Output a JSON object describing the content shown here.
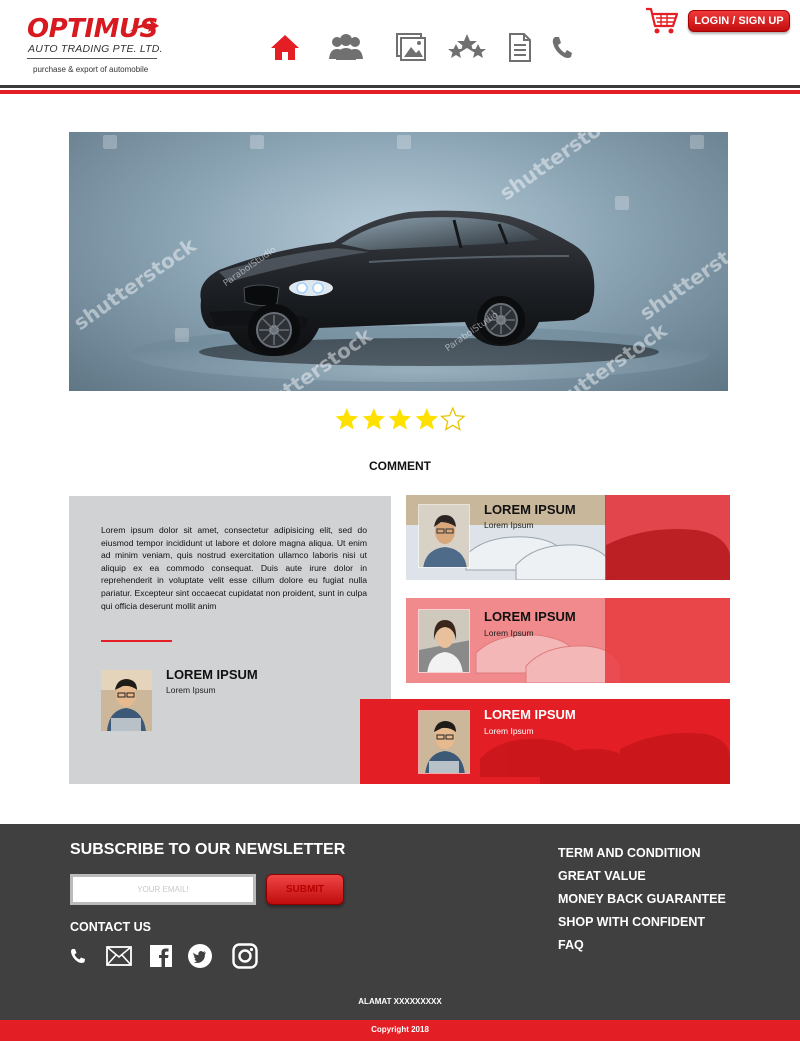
{
  "brand": {
    "name": "OPTIMUS",
    "subtitle": "AUTO TRADING PTE. LTD.",
    "tagline": "purchase & export of automobile",
    "accent": "#e31e24",
    "dark": "#404041"
  },
  "nav": {
    "items": [
      {
        "icon": "home-icon",
        "active": true
      },
      {
        "icon": "users-icon",
        "active": false
      },
      {
        "icon": "gallery-icon",
        "active": false
      },
      {
        "icon": "stars-icon",
        "active": false
      },
      {
        "icon": "document-icon",
        "active": false
      },
      {
        "icon": "phone-icon",
        "active": false
      }
    ]
  },
  "header": {
    "cart_icon": "shopping-cart-icon",
    "login_label": "LOGIN / SIGN UP"
  },
  "hero": {
    "watermark": "shutterstock",
    "credit": "ParabolStudio"
  },
  "rating": {
    "value": 4,
    "max": 5
  },
  "comments": {
    "title": "COMMENT",
    "featured": {
      "text": "Lorem ipsum dolor sit amet, consectetur adipisicing elit, sed do eiusmod tempor incididunt ut labore et dolore magna aliqua. Ut enim ad minim veniam, quis nostrud exercitation ullamco laboris nisi ut aliquip ex ea commodo consequat. Duis aute irure dolor in reprehenderit in voluptate velit esse cillum dolore eu fugiat nulla pariatur. Excepteur sint occaecat cupidatat non proident, sunt in culpa qui officia deserunt mollit anim",
      "name": "LOREM IPSUM",
      "role": "Lorem Ipsum"
    },
    "cards": [
      {
        "name": "LOREM IPSUM",
        "role": "Lorem Ipsum"
      },
      {
        "name": "LOREM IPSUM",
        "role": "Lorem Ipsum"
      },
      {
        "name": "LOREM IPSUM",
        "role": "Lorem Ipsum"
      }
    ]
  },
  "footer": {
    "newsletter_title": "SUBSCRIBE TO OUR NEWSLETTER",
    "email_placeholder": "YOUR EMAIL!",
    "submit_label": "SUBMIT",
    "contact_title": "CONTACT US",
    "socials": [
      "phone-icon",
      "mail-icon",
      "facebook-icon",
      "twitter-icon",
      "instagram-icon"
    ],
    "links": [
      "TERM AND CONDITIION",
      "GREAT VALUE",
      "MONEY BACK GUARANTEE",
      "SHOP WITH CONFIDENT",
      "FAQ"
    ],
    "address": "ALAMAT XXXXXXXXX",
    "copyright": "Copyright 2018"
  }
}
